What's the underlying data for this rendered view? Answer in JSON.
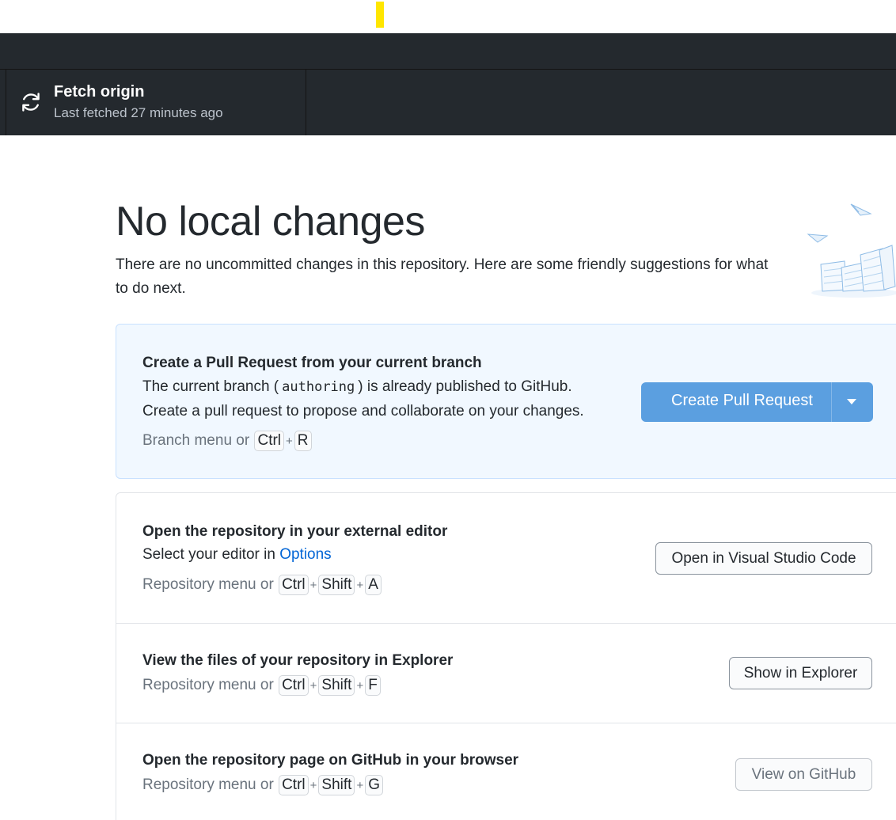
{
  "toolbar": {
    "fetch_title": "Fetch origin",
    "fetch_subtitle": "Last fetched 27 minutes ago",
    "fetch_icon": "sync-icon"
  },
  "main": {
    "heading": "No local changes",
    "intro": "There are no uncommitted changes in this repository. Here are some friendly suggestions for what to do next.",
    "illustration": "empty-repo-illustration"
  },
  "pull_request": {
    "title": "Create a Pull Request from your current branch",
    "line1_before": "The current branch (",
    "branch": "authoring",
    "line1_after": ") is already published to GitHub.",
    "line2": "Create a pull request to propose and collaborate on your changes.",
    "hint_prefix": "Branch menu or",
    "keys": [
      "Ctrl",
      "R"
    ],
    "button_label": "Create Pull Request",
    "button_color": "#5b9fe0"
  },
  "open_editor": {
    "title": "Open the repository in your external editor",
    "text_before": "Select your editor in",
    "text_link": "Options",
    "hint_prefix": "Repository menu or",
    "keys": [
      "Ctrl",
      "Shift",
      "A"
    ],
    "button_label": "Open in Visual Studio Code"
  },
  "explorer": {
    "title": "View the files of your repository in Explorer",
    "hint_prefix": "Repository menu or",
    "keys": [
      "Ctrl",
      "Shift",
      "F"
    ],
    "button_label": "Show in Explorer"
  },
  "github": {
    "title": "Open the repository page on GitHub in your browser",
    "hint_prefix": "Repository menu or",
    "keys": [
      "Ctrl",
      "Shift",
      "G"
    ],
    "button_label": "View on GitHub"
  },
  "colors": {
    "toolbar_bg": "#24292e",
    "pr_card_bg": "#f1f8ff",
    "link": "#0366d6"
  }
}
